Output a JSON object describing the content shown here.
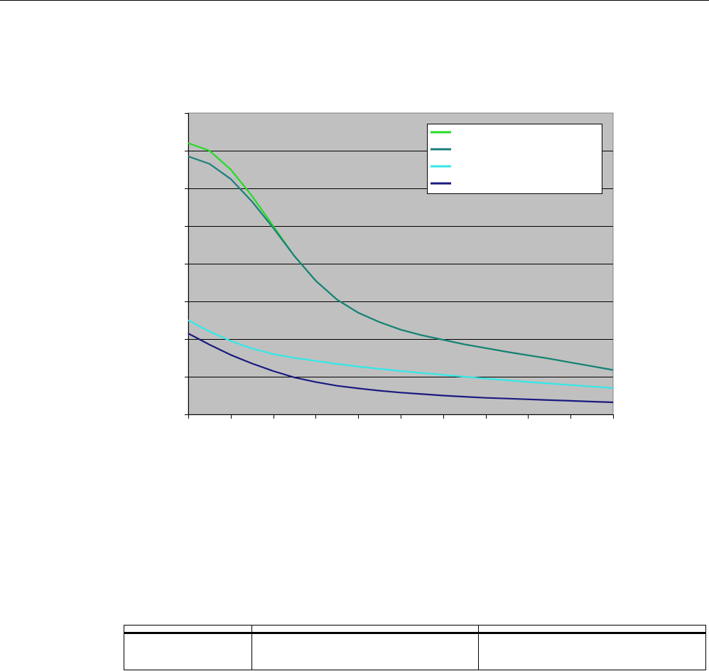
{
  "chart_data": {
    "type": "line",
    "title": "",
    "xlabel": "",
    "ylabel": "",
    "grid": true,
    "legend_position": "top-right",
    "x": [
      0,
      0.5,
      1,
      1.5,
      2,
      2.5,
      3,
      3.5,
      4,
      4.5,
      5,
      5.5,
      6,
      6.5,
      7,
      7.5,
      8,
      8.5,
      9,
      9.5,
      10
    ],
    "xlim": [
      0,
      10
    ],
    "ylim": [
      0,
      8
    ],
    "x_ticks": 10,
    "y_ticks": 8,
    "series": [
      {
        "color": "#22dd22",
        "values": [
          7.2,
          7.0,
          6.5,
          5.8,
          5.0,
          4.2,
          3.55,
          3.05,
          2.7,
          2.45,
          2.25,
          2.1,
          1.98,
          1.86,
          1.76,
          1.66,
          1.57,
          1.48,
          1.38,
          1.28,
          1.18
        ]
      },
      {
        "color": "#1a7f7a",
        "values": [
          6.85,
          6.65,
          6.25,
          5.65,
          4.95,
          4.2,
          3.55,
          3.05,
          2.7,
          2.45,
          2.25,
          2.1,
          1.98,
          1.86,
          1.76,
          1.66,
          1.57,
          1.48,
          1.38,
          1.28,
          1.18
        ]
      },
      {
        "color": "#33e8e8",
        "values": [
          2.5,
          2.2,
          1.95,
          1.75,
          1.6,
          1.5,
          1.42,
          1.34,
          1.27,
          1.21,
          1.15,
          1.1,
          1.05,
          1.0,
          0.95,
          0.91,
          0.86,
          0.82,
          0.78,
          0.74,
          0.7
        ]
      },
      {
        "color": "#1a1a80",
        "values": [
          2.15,
          1.85,
          1.58,
          1.35,
          1.15,
          0.98,
          0.86,
          0.76,
          0.69,
          0.63,
          0.58,
          0.54,
          0.5,
          0.47,
          0.44,
          0.42,
          0.4,
          0.38,
          0.36,
          0.34,
          0.32
        ]
      }
    ]
  },
  "colors": {
    "plot_background": "#c0c0c0",
    "gridline": "#000000"
  }
}
